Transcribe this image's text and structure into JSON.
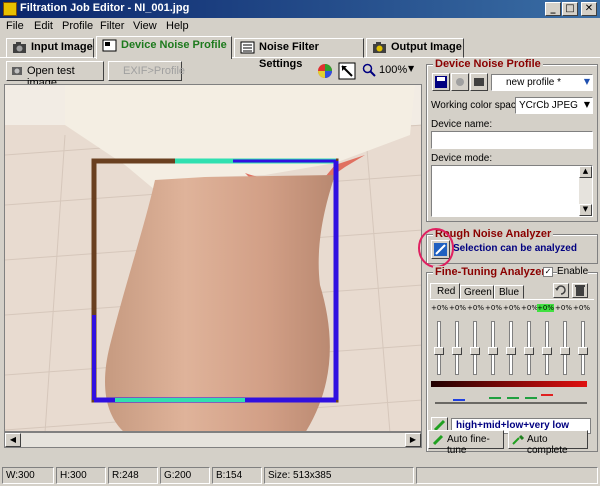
{
  "window": {
    "title": "Filtration Job Editor - NI_001.jpg"
  },
  "menu": [
    "File",
    "Edit",
    "Profile",
    "Filter",
    "View",
    "Help"
  ],
  "tabs": [
    {
      "label": "Input Image"
    },
    {
      "label": "Device Noise Profile"
    },
    {
      "label": "Noise Filter Settings"
    },
    {
      "label": "Output Image"
    }
  ],
  "toolbar": {
    "open_test_image": "Open test image",
    "exif_profile": "EXIF>Profile",
    "zoom": "100%"
  },
  "status": {
    "w": "W:300",
    "h": "H:300",
    "r": "R:248",
    "g": "G:200",
    "b": "B:154",
    "size": "Size: 513x385"
  },
  "device_profile": {
    "title": "Device Noise Profile",
    "profile_name": "new profile *",
    "working_color_space_label": "Working color space:",
    "working_color_space": "YCrCb JPEG",
    "device_name_label": "Device name:",
    "device_name": "",
    "device_mode_label": "Device mode:",
    "device_mode": ""
  },
  "rough_analyzer": {
    "title": "Rough Noise Analyzer",
    "message": "Selection can be analyzed"
  },
  "fine_tuning": {
    "title": "Fine-Tuning Analyzer",
    "enable_label": "Enable",
    "enabled": true,
    "channel_tabs": [
      "Red",
      "Green",
      "Blue"
    ],
    "percentages": [
      "+0%",
      "+0%",
      "+0%",
      "+0%",
      "+0%",
      "+0%",
      "+0%",
      "+0%",
      "+0%"
    ],
    "highlight_index": 6,
    "freq_label": "high+mid+low+very low freq",
    "auto_fine_tune": "Auto fine-tune",
    "auto_complete": "Auto complete"
  },
  "colors": {
    "title_start": "#0a246a",
    "title_end": "#3a6ea5",
    "group_title": "#8a0000",
    "active_tab": "#1d7a1d",
    "selection_cyan": "#30e0b0",
    "selection_blue": "#3010e0",
    "selection_brown": "#6a4020",
    "info_text": "#000080"
  }
}
